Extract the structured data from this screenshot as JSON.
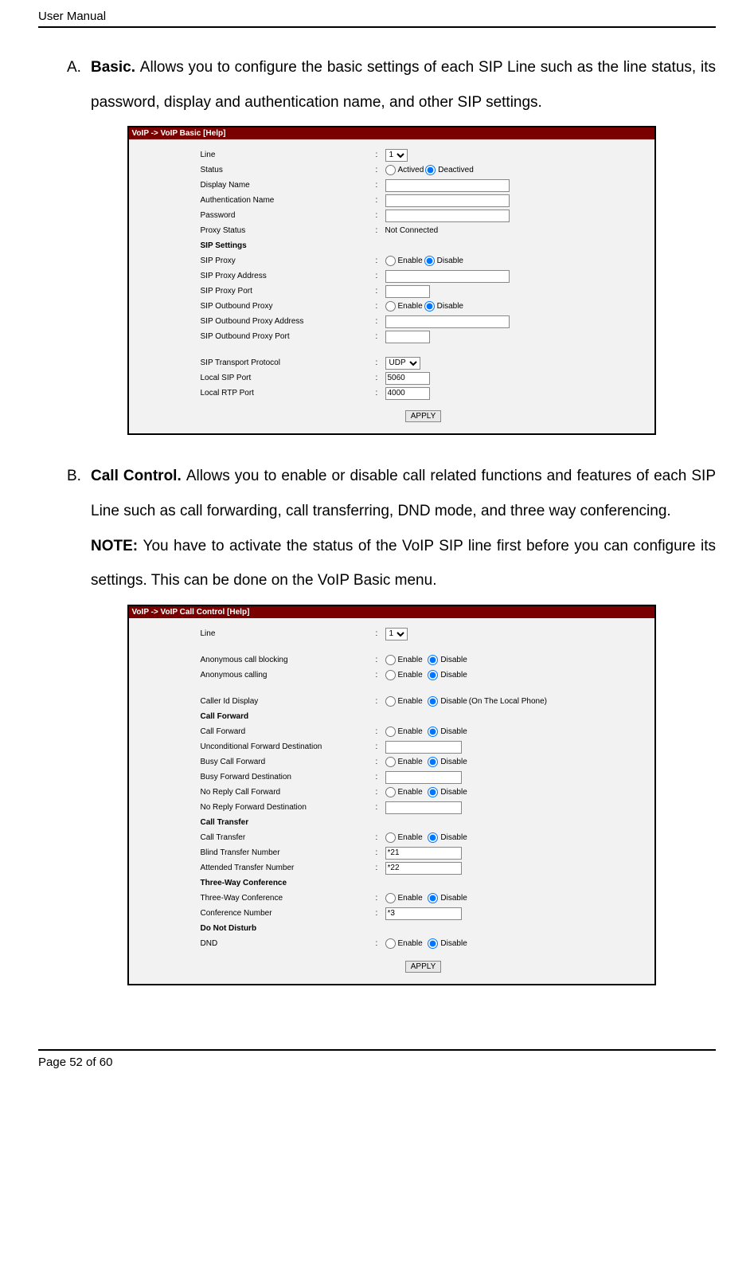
{
  "header": "User Manual",
  "footer": {
    "prefix": "Page ",
    "num": "52",
    "of": " of 60"
  },
  "sectA": {
    "marker": "A.",
    "title": "Basic. ",
    "body": "Allows you to configure the basic settings of each SIP Line such as the line status, its password, display and authentication name, and other SIP settings."
  },
  "sectB": {
    "marker": "B.",
    "title": "Call Control. ",
    "body": "Allows you to enable or disable call related functions and features of each SIP Line such as call forwarding, call transferring, DND mode, and three way conferencing.",
    "noteLabel": "NOTE: ",
    "note": "You have to activate the status of the VoIP SIP line first before you can configure its settings. This can be done on the VoIP Basic menu."
  },
  "panelA": {
    "title": "VoIP -> VoIP Basic ",
    "help": "[Help]",
    "labels": {
      "line": "Line",
      "status": "Status",
      "dispName": "Display Name",
      "authName": "Authentication Name",
      "password": "Password",
      "proxyStatus": "Proxy Status",
      "sipSettings": "SIP Settings",
      "sipProxy": "SIP Proxy",
      "sipProxyAddr": "SIP Proxy Address",
      "sipProxyPort": "SIP Proxy Port",
      "sipOutProxy": "SIP Outbound Proxy",
      "sipOutProxyAddr": "SIP Outbound Proxy Address",
      "sipOutProxyPort": "SIP Outbound Proxy Port",
      "sipTransport": "SIP Transport Protocol",
      "localSipPort": "Local SIP Port",
      "localRtpPort": "Local RTP Port"
    },
    "values": {
      "line": "1",
      "actived": "Actived",
      "deactived": "Deactived",
      "notConnected": "Not Connected",
      "enable": "Enable",
      "disable": "Disable",
      "udp": "UDP",
      "sipPort": "5060",
      "rtpPort": "4000",
      "apply": "APPLY"
    }
  },
  "panelB": {
    "title": "VoIP -> VoIP Call Control ",
    "help": "[Help]",
    "labels": {
      "line": "Line",
      "anonBlock": "Anonymous call blocking",
      "anonCall": "Anonymous calling",
      "callerId": "Caller Id Display",
      "callFwdHead": "Call Forward",
      "callFwd": "Call Forward",
      "uncondDest": "Unconditional Forward Destination",
      "busyFwd": "Busy Call Forward",
      "busyDest": "Busy Forward Destination",
      "noReplyFwd": "No Reply Call Forward",
      "noReplyDest": "No Reply Forward Destination",
      "callTransHead": "Call Transfer",
      "callTrans": "Call Transfer",
      "blindNum": "Blind Transfer Number",
      "attNum": "Attended Transfer Number",
      "threeWayHead": "Three-Way Conference",
      "threeWay": "Three-Way Conference",
      "confNum": "Conference Number",
      "dndHead": "Do Not Disturb",
      "dnd": "DND"
    },
    "values": {
      "line": "1",
      "enable": "Enable",
      "disable": "Disable",
      "localPhone": " (On The Local Phone)",
      "blind": "*21",
      "att": "*22",
      "conf": "*3",
      "apply": "APPLY"
    }
  }
}
